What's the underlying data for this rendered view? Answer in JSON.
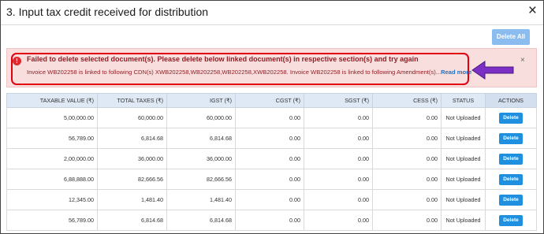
{
  "modal": {
    "title": "3. Input tax credit received for distribution",
    "close": "×"
  },
  "toolbar": {
    "delete_all": "Delete All"
  },
  "alert": {
    "icon": "!",
    "title": "Failed to delete selected document(s). Please delete below linked document(s) in respective section(s) and try again",
    "message": "Invoice WB202258 is linked to following CDN(s) XWB202258,WB202258,WB202258,XWB202258. Invoice WB202258 is linked to following Amendment(s)...",
    "read_more": "Read more",
    "dismiss": "×"
  },
  "colors": {
    "alert_bg": "#f9dede",
    "alert_text": "#8e2026",
    "highlight_border": "#e00012",
    "arrow": "#7b2fc4",
    "primary_button": "#1f8fe0"
  },
  "table": {
    "headers": [
      "TAXABLE VALUE (₹)",
      "TOTAL TAXES (₹)",
      "IGST (₹)",
      "CGST (₹)",
      "SGST (₹)",
      "CESS (₹)",
      "STATUS",
      "ACTIONS"
    ],
    "rows": [
      [
        "5,00,000.00",
        "60,000.00",
        "60,000.00",
        "0.00",
        "0.00",
        "0.00",
        "Not Uploaded",
        "Delete"
      ],
      [
        "56,789.00",
        "6,814.68",
        "6,814.68",
        "0.00",
        "0.00",
        "0.00",
        "Not Uploaded",
        "Delete"
      ],
      [
        "2,00,000.00",
        "36,000.00",
        "36,000.00",
        "0.00",
        "0.00",
        "0.00",
        "Not Uploaded",
        "Delete"
      ],
      [
        "6,88,888.00",
        "82,666.56",
        "82,666.56",
        "0.00",
        "0.00",
        "0.00",
        "Not Uploaded",
        "Delete"
      ],
      [
        "12,345.00",
        "1,481.40",
        "1,481.40",
        "0.00",
        "0.00",
        "0.00",
        "Not Uploaded",
        "Delete"
      ],
      [
        "56,789.00",
        "6,814.68",
        "6,814.68",
        "0.00",
        "0.00",
        "0.00",
        "Not Uploaded",
        "Delete"
      ]
    ]
  }
}
